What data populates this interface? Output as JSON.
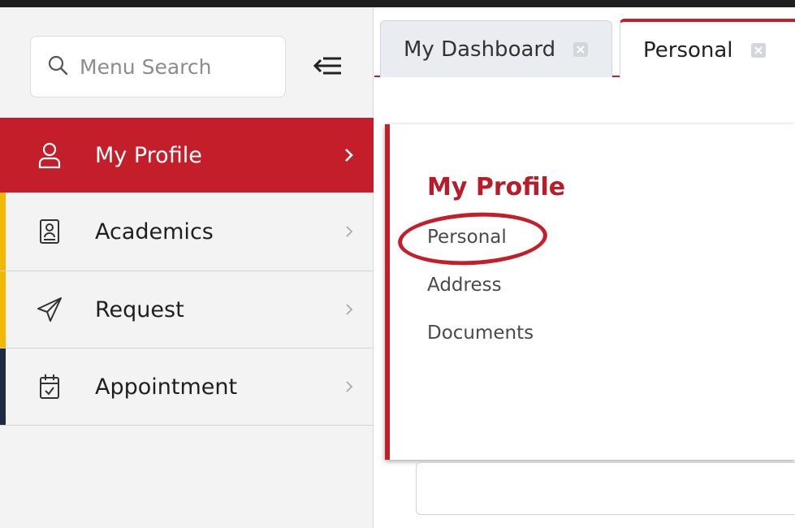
{
  "search": {
    "placeholder": "Menu Search"
  },
  "sidebar": {
    "items": [
      {
        "label": "My Profile",
        "icon": "user-icon",
        "active": true
      },
      {
        "label": "Academics",
        "icon": "id-card-icon",
        "accent": "#f2b705"
      },
      {
        "label": "Request",
        "icon": "paper-plane-icon",
        "accent": "#f2b705"
      },
      {
        "label": "Appointment",
        "icon": "calendar-check-icon",
        "accent": "#1f2a44"
      }
    ]
  },
  "tabs": [
    {
      "label": "My Dashboard"
    },
    {
      "label": "Personal",
      "active": true
    }
  ],
  "panel": {
    "title": "My Profile",
    "links": [
      "Personal",
      "Address",
      "Documents"
    ]
  },
  "colors": {
    "brand": "#c41e2b",
    "accent_yellow": "#f2b705",
    "accent_navy": "#1f2a44"
  }
}
